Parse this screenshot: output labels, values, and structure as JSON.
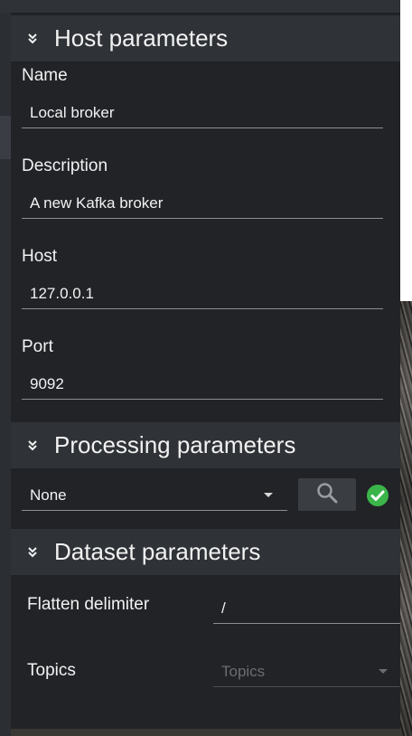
{
  "host_section": {
    "title": "Host parameters",
    "fields": [
      {
        "label": "Name",
        "value": "Local broker"
      },
      {
        "label": "Description",
        "value": "A new Kafka broker"
      },
      {
        "label": "Host",
        "value": "127.0.0.1"
      },
      {
        "label": "Port",
        "value": "9092"
      }
    ]
  },
  "processing_section": {
    "title": "Processing parameters",
    "selected": "None",
    "search_icon": "search-icon",
    "status_icon": "check-circle-icon",
    "status_color": "#3bb54a"
  },
  "dataset_section": {
    "title": "Dataset parameters",
    "flatten_label": "Flatten delimiter",
    "flatten_value": "/",
    "topics_label": "Topics",
    "topics_placeholder": "Topics"
  },
  "colors": {
    "panel_bg": "#212327",
    "header_bg": "#2f3236",
    "text": "#f2f2f2",
    "accent_ok": "#3bb54a"
  }
}
